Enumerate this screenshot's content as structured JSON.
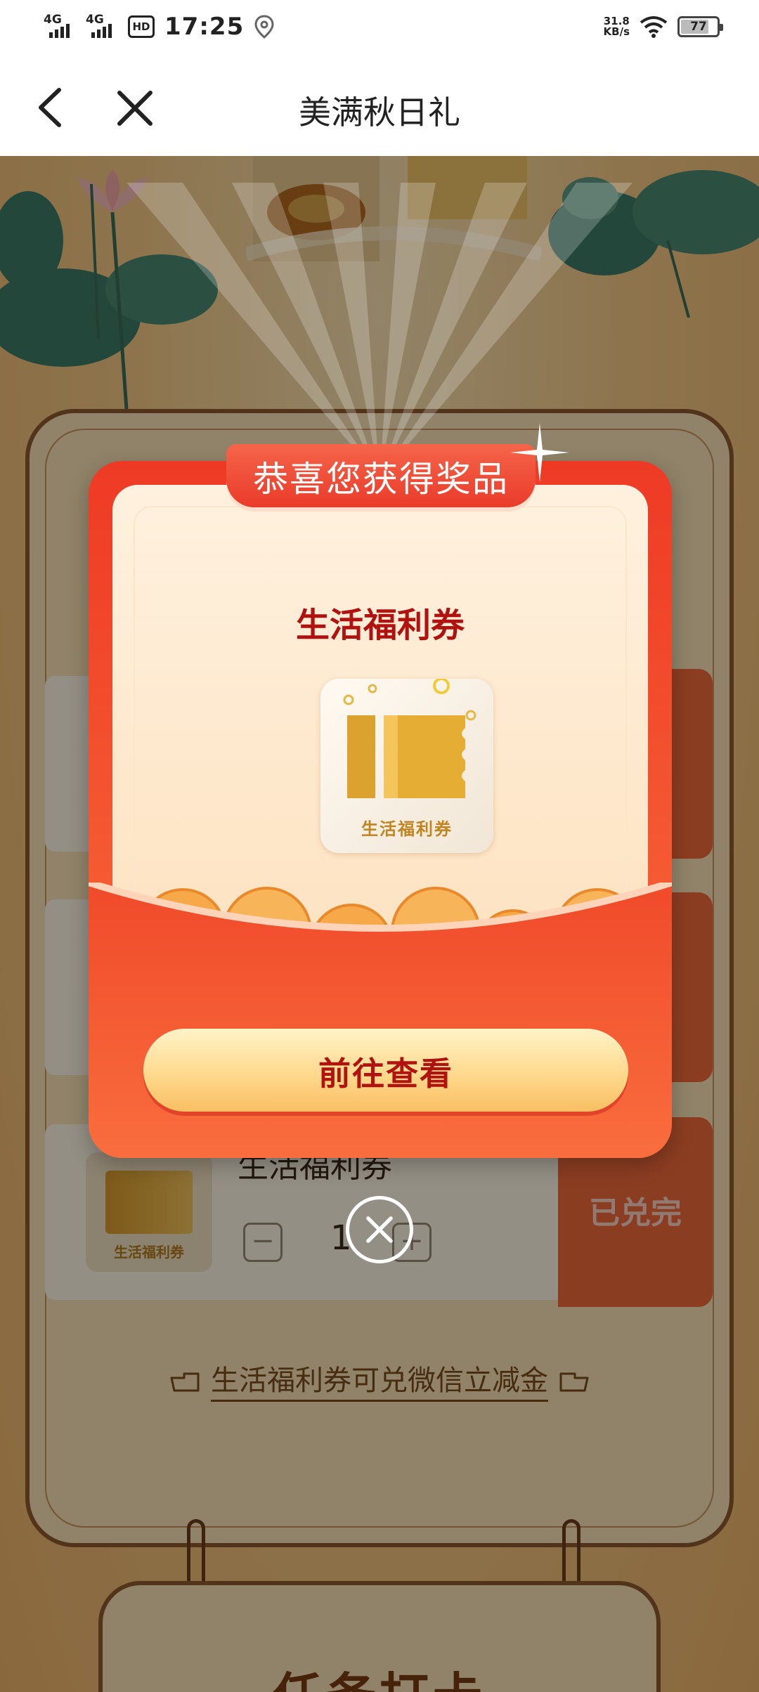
{
  "status_bar": {
    "signal1_label": "4G",
    "signal2_label": "4G",
    "hd_label": "HD",
    "time": "17:25",
    "speed_value": "31.8",
    "speed_unit": "KB/s",
    "battery": "77"
  },
  "titlebar": {
    "title": "美满秋日礼"
  },
  "background": {
    "card3_name": "生活福利券",
    "card3_thumb_label": "生活福利券",
    "card3_qty": "1",
    "card3_button": "已兑完",
    "minus": "−",
    "plus": "+",
    "link_text": "生活福利券可兑微信立减金",
    "task_title": "任务打卡"
  },
  "modal": {
    "ribbon": "恭喜您获得奖品",
    "prize_name": "生活福利券",
    "prize_icon_label": "生活福利券",
    "cta": "前往查看"
  },
  "colors": {
    "accent_red": "#ee3a25",
    "prize_text": "#b0130f",
    "gold": "#f9bf62"
  },
  "icons": [
    "back-arrow-icon",
    "close-icon",
    "location-icon",
    "wifi-icon",
    "battery-icon",
    "ticket-icon",
    "hand-pointer-icon",
    "dismiss-icon"
  ]
}
